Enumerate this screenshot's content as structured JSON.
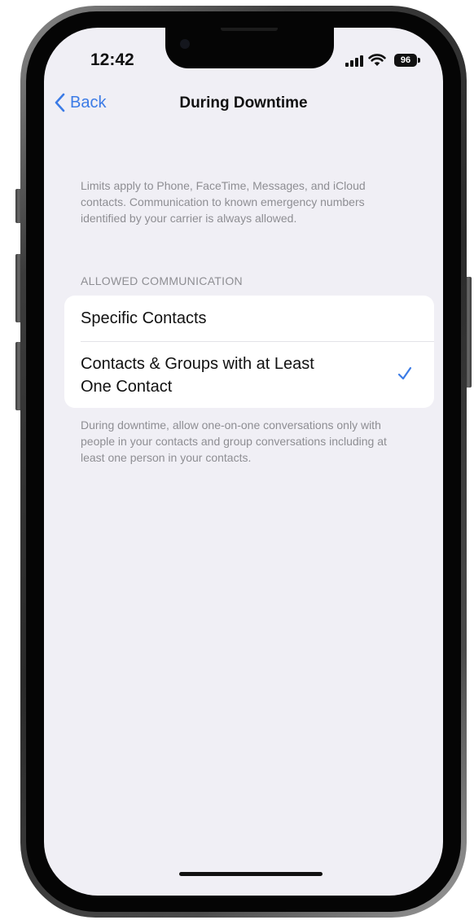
{
  "status_bar": {
    "time": "12:42",
    "battery_level": "96",
    "signal_icon": "cellular-signal-icon",
    "wifi_icon": "wifi-icon"
  },
  "nav": {
    "back_label": "Back",
    "title": "During Downtime"
  },
  "info_text": "Limits apply to Phone, FaceTime, Messages, and iCloud contacts. Communication to known emergency numbers identified by your carrier is always allowed.",
  "section_header": "ALLOWED COMMUNICATION",
  "options": [
    {
      "label": "Specific Contacts",
      "selected": false
    },
    {
      "label": "Contacts & Groups with at Least One Contact",
      "selected": true
    }
  ],
  "footer_text": "During downtime, allow one-on-one conversations only with people in your contacts and group conversations including at least one person in your contacts.",
  "colors": {
    "accent": "#3b7be6",
    "background": "#f0eff5",
    "secondary_text": "#8e8e93"
  }
}
